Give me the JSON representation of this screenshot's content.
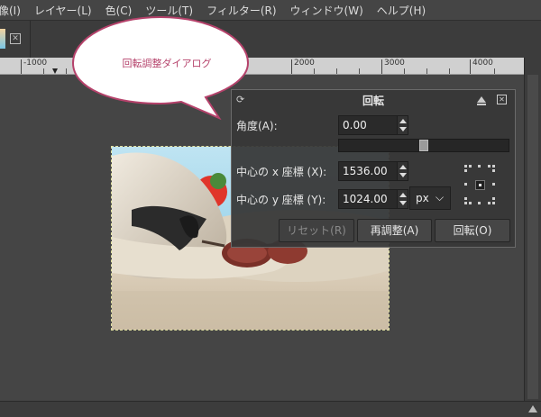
{
  "menu": {
    "items": [
      "像(I)",
      "レイヤー(L)",
      "色(C)",
      "ツール(T)",
      "フィルター(R)",
      "ウィンドウ(W)",
      "ヘルプ(H)"
    ]
  },
  "ruler": {
    "labels": [
      "-1000",
      "2000",
      "3000",
      "4000"
    ]
  },
  "annotation": {
    "text": "回転調整ダイアログ",
    "color": "#b5426b"
  },
  "dialog": {
    "title": "回転",
    "angle": {
      "label": "角度(A):",
      "value": "0.00"
    },
    "angle_slider_fraction": 0.5,
    "center_x": {
      "label": "中心の x 座標 (X):",
      "value": "1536.00"
    },
    "center_y": {
      "label": "中心の y 座標 (Y):",
      "value": "1024.00"
    },
    "unit": {
      "selected": "px"
    },
    "buttons": {
      "reset": "リセット(R)",
      "readjust": "再調整(A)",
      "rotate": "回転(O)"
    }
  },
  "icons": {
    "tool_icon": "rotate-tool-icon",
    "minimize": "minimize-icon",
    "close": "close-icon",
    "chevron": "chevron-down-icon",
    "pivot": "pivot-selector-icon"
  }
}
